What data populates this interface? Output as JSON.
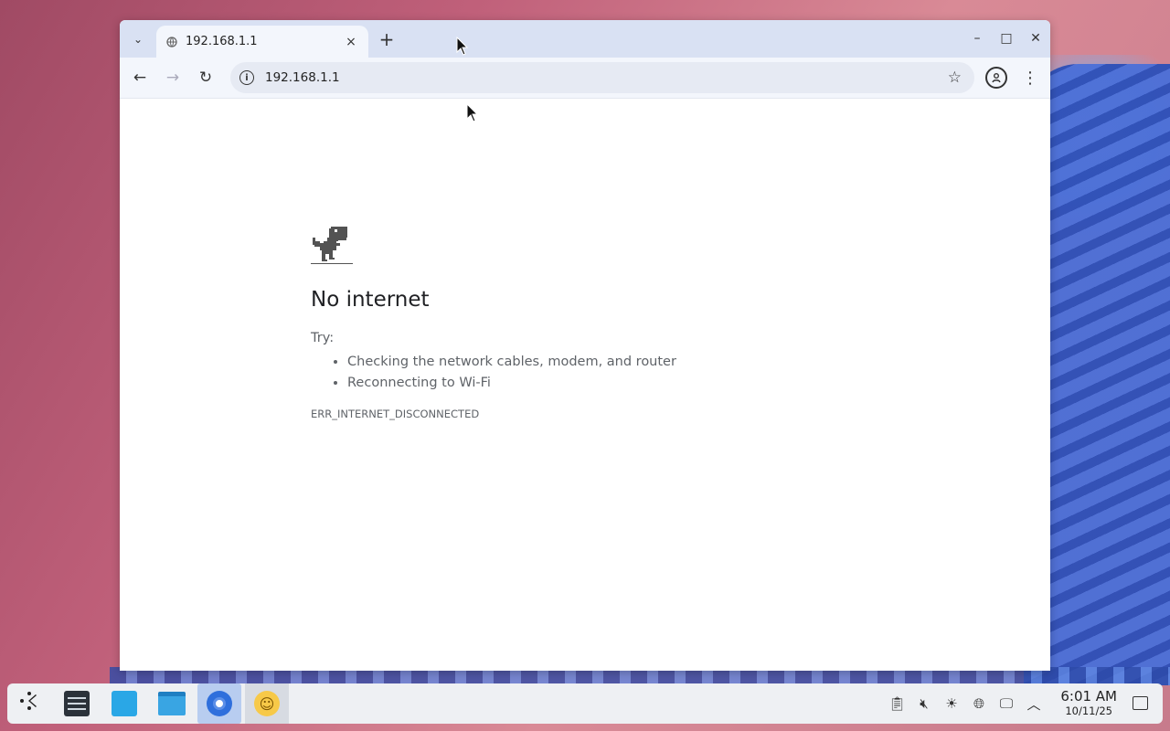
{
  "browser": {
    "tab": {
      "title": "192.168.1.1",
      "close": "×"
    },
    "new_tab": "+",
    "window_controls": {
      "minimize": "–",
      "maximize": "□",
      "close": "✕"
    },
    "toolbar": {
      "back": "←",
      "forward": "→",
      "reload": "↻",
      "url": "192.168.1.1",
      "bookmark": "☆",
      "menu": "⋮"
    }
  },
  "error_page": {
    "title": "No internet",
    "try_label": "Try:",
    "suggestions": [
      "Checking the network cables, modem, and router",
      "Reconnecting to Wi-Fi"
    ],
    "error_code": "ERR_INTERNET_DISCONNECTED"
  },
  "taskbar": {
    "clock": {
      "time": "6:01 AM",
      "date": "10/11/25"
    },
    "tray_icons": [
      "clipboard-icon",
      "volume-muted-icon",
      "brightness-icon",
      "network-icon",
      "display-icon",
      "chevron-up-icon"
    ],
    "apps": [
      "launcher-icon",
      "system-settings-icon",
      "discover-icon",
      "file-manager-icon",
      "chromium-icon",
      "emoji-picker-icon"
    ]
  }
}
